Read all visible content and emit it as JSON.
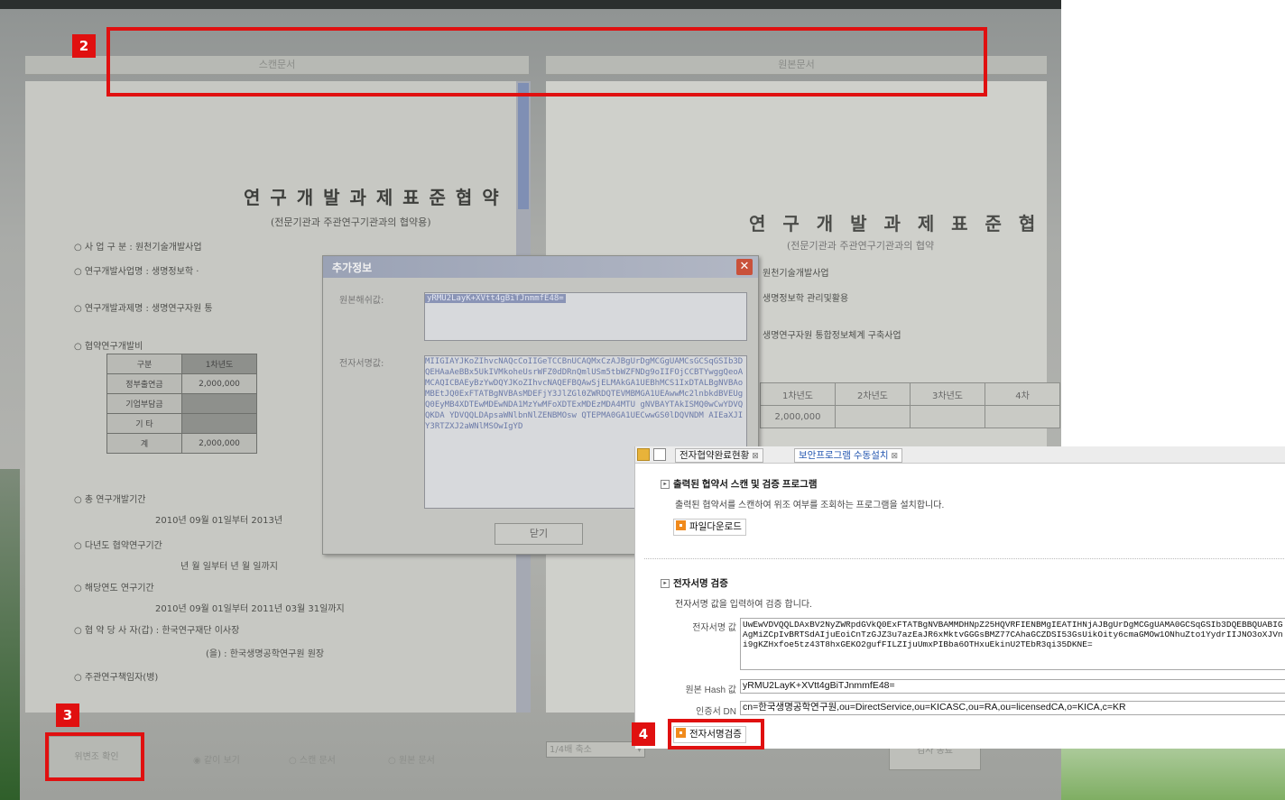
{
  "left_pane": {
    "header": "스캔문서",
    "doc_title": "연 구 개 발 과 제 표 준 협 약",
    "doc_subtitle": "(전문기관과 주관연구기관과의 협약용)",
    "lines": [
      "○ 사 업 구 분 :   원천기술개발사업",
      "○ 연구개발사업명 :   생명정보학 ·",
      "○ 연구개발과제명 :   생명연구자원 통",
      "○ 협약연구개발비",
      "○ 총 연구개발기간",
      "2010년 09월 01일부터 2013년",
      "○ 다년도 협약연구기간",
      "년  월  일부터   년  월  일까지",
      "○ 해당연도 연구기간",
      "2010년 09월 01일부터 2011년 03월 31일까지",
      "○ 협 약 당 사 자(갑) :  한국연구재단 이사장",
      "(을) :  한국생명공학연구원 원장",
      "○ 주관연구책임자(병)"
    ],
    "table": [
      [
        "구분",
        "1차년도"
      ],
      [
        "정부출연금",
        "2,000,000"
      ],
      [
        "기업부담금",
        ""
      ],
      [
        "기    타",
        ""
      ],
      [
        "계",
        "2,000,000"
      ]
    ]
  },
  "right_pane": {
    "header": "원본문서",
    "doc_title": "연 구 개 발 과 제 표 준 협",
    "doc_subtitle": "(전문기관과 주관연구기관과의 협약",
    "lines": [
      "원천기술개발사업",
      "생명정보학  관리및활용",
      "생명연구자원 통합정보체계 구축사업"
    ],
    "table": [
      [
        "1차년도",
        "2차년도",
        "3차년도",
        "4차"
      ],
      [
        "2,000,000",
        "",
        "",
        ""
      ]
    ]
  },
  "dialog": {
    "title": "추가정보",
    "hash_label": "원본해쉬값:",
    "hash_value": "yRMU2LayK+XVtt4gBiTJnmmfE48=",
    "sig_label": "전자서명값:",
    "sig_value": "MIIGIAYJKoZIhvcNAQcCoIIGeTCCBnUCAQMxCzAJBgUrDgMCGgUAMCsGCSqGSIb3DQEHAaAeBBx5UkIVMkoheUsrWFZ0dDRnQmlUSm5tbWZFNDg9oIIFOjCCBTYwggQeoAMCAQICBAEyBzYwDQYJKoZIhvcNAQEFBQAwSjELMAkGA1UEBhMCS1IxDTALBgNVBAoMBEtJQ0ExFTATBgNVBAsMDEFjY3JlZGl0ZWRDQTEVMBMGA1UEAwwMc2lnbkdBVEUgQ0EyMB4XDTEwMDEwNDA1MzYwMFoXDTExMDEzMDA4MTU",
    "sig_value_tail": "gNVBAYTAkISMQ0wCwYDVQQKDA YDVQQLDApsaWNlbnNlZENBMOsw QTEPMA0GA1UECwwGS0lDQVNDM AIEaXJIY3RTZXJ2aWNlMSOwIgYD",
    "close_label": "닫기"
  },
  "bottom_bar": {
    "verify_button": "위변조 확인",
    "radio_both": "같이 보기",
    "radio_scan": "스캔 문서",
    "radio_original": "원본 문서",
    "zoom_value": "1/4배 축소",
    "end_button": "검사 종료"
  },
  "web": {
    "tab1": "전자협약완료현황",
    "tab2": "보안프로그램 수동설치",
    "section1_title": "출력된 협약서 스캔 및 검증 프로그램",
    "section1_desc": "출력된 협약서를 스캔하여 위조 여부를 조회하는 프로그램을 설치합니다.",
    "download_button": "파일다운로드",
    "section2_title": "전자서명 검증",
    "section2_desc": "전자서명 값을 입력하여 검증 합니다.",
    "sig_label": "전자서명 값",
    "sig_value": "UwEwVDVQQLDAxBV2NyZWRpdGVkQ0ExFTATBgNVBAMMDHNpZ25HQVRFIENBMgIEATIHNjAJBgUrDgMCGgUAMA0GCSqGSIb3DQEBBQUABIGAgMiZCpIvBRTSdAIjuEoiCnTzGJZ3u7azEaJR6xMktvGGGsBMZ77CAhaGCZDSI53GsUikOity6cmaGMOw1ONhuZto1YydrIIJNO3oXJVni9gKZHxfoe5tz43T8hxGEKO2gufFILZIjuUmxPIBba6OTHxuEkinU2TEbR3qi35DKNE=",
    "hash_label": "원본 Hash 값",
    "hash_value": "yRMU2LayK+XVtt4gBiTJnmmfE48=",
    "dn_label": "인증서 DN",
    "dn_value": "cn=한국생명공학연구원,ou=DirectService,ou=KICASC,ou=RA,ou=licensedCA,o=KICA,c=KR",
    "verify_button": "전자서명검증"
  },
  "callouts": {
    "c2": "2",
    "c3": "3",
    "c4": "4"
  },
  "colors": {
    "callout_red": "#e01010",
    "button_orange": "#f08a1c"
  }
}
